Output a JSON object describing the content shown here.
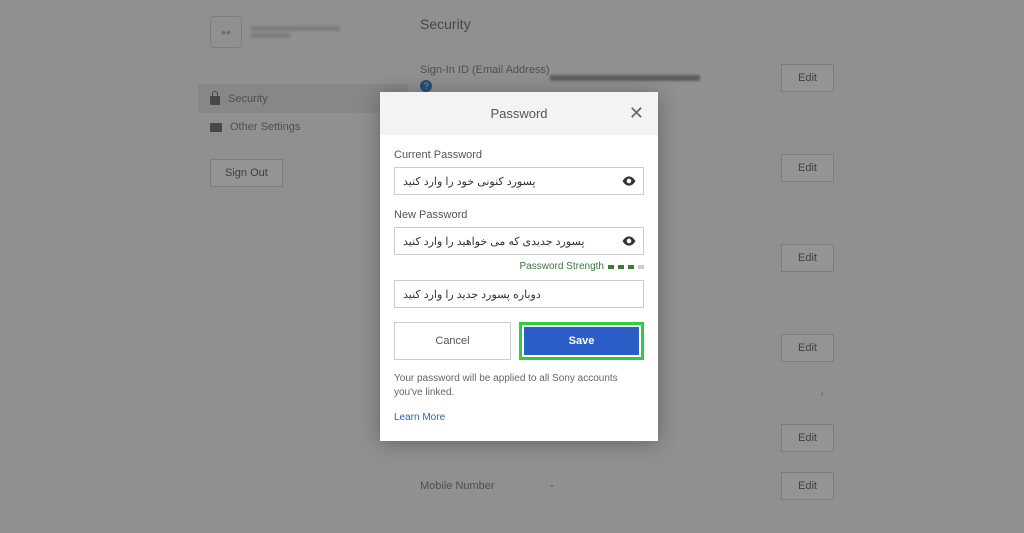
{
  "page": {
    "title": "Security"
  },
  "sidebar": {
    "items": [
      {
        "label": "Security"
      },
      {
        "label": "Other Settings"
      }
    ],
    "signout_label": "Sign Out"
  },
  "rows": {
    "signin_id_label": "Sign-In ID (Email Address)",
    "mobile_label": "Mobile Number",
    "mobile_value": "-",
    "edit_label": "Edit"
  },
  "modal": {
    "title": "Password",
    "current_label": "Current Password",
    "current_value": "پسورد کنونی خود را وارد کنید",
    "new_label": "New Password",
    "new_value": "پسورد جدیدی که می خواهید را وارد کنید",
    "strength_label": "Password Strength",
    "confirm_value": "دوباره پسورد جدید را وارد کنید",
    "cancel_label": "Cancel",
    "save_label": "Save",
    "info_text": "Your password will be applied to all Sony accounts you've linked.",
    "learn_more": "Learn More"
  }
}
